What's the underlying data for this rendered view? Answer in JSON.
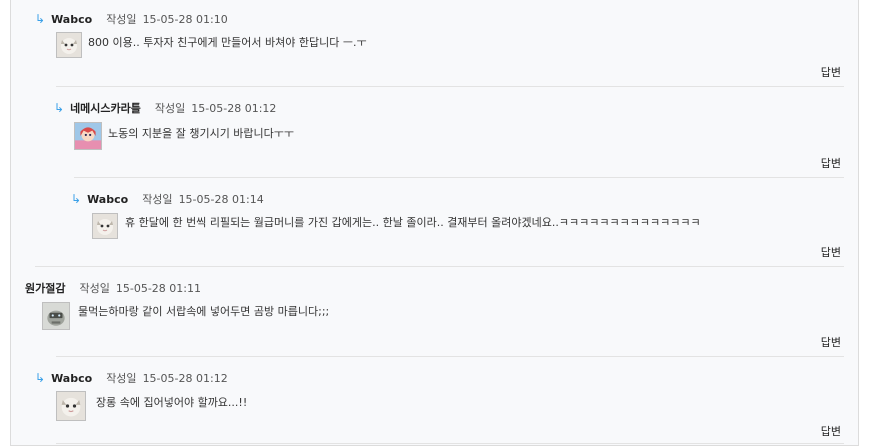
{
  "labels": {
    "meta": "작성일",
    "reply": "답변"
  },
  "icons": {
    "reply_arrow": "reply-arrow-icon"
  },
  "colors": {
    "arrow": "#3aa0e8",
    "separator": "#e3e3e3",
    "panel": "#f8f9fb"
  },
  "comments": [
    {
      "author": "Wabco",
      "date": "15-05-28 01:10",
      "text": "800 이용.. 투자자 친구에게 만들어서 바쳐야 한답니다 ㅡ.ㅜ",
      "indent": 1,
      "avatar": "cat"
    },
    {
      "author": "네메시스카라틀",
      "date": "15-05-28 01:12",
      "text": "노동의 지분을 잘 챙기시기 바랍니다ㅜㅜ",
      "indent": 2,
      "avatar": "anime"
    },
    {
      "author": "Wabco",
      "date": "15-05-28 01:14",
      "text": "휴 한달에 한 번씩 리필되는 월급머니를 가진 갑에게는.. 한날 졸이라.. 결재부터 올려야겠네요..ㅋㅋㅋㅋㅋㅋㅋㅋㅋㅋㅋㅋㅋㅋ",
      "indent": 3,
      "avatar": "cat"
    },
    {
      "author": "원가절감",
      "date": "15-05-28 01:11",
      "text": "물먹는하마랑 같이 서랍속에 넣어두면 곰방 마릅니다;;;",
      "indent": 0,
      "avatar": "robot"
    },
    {
      "author": "Wabco",
      "date": "15-05-28 01:12",
      "text": "장롱 속에 집어넣어야 할까요...!!",
      "indent": 1,
      "avatar": "cat"
    }
  ]
}
